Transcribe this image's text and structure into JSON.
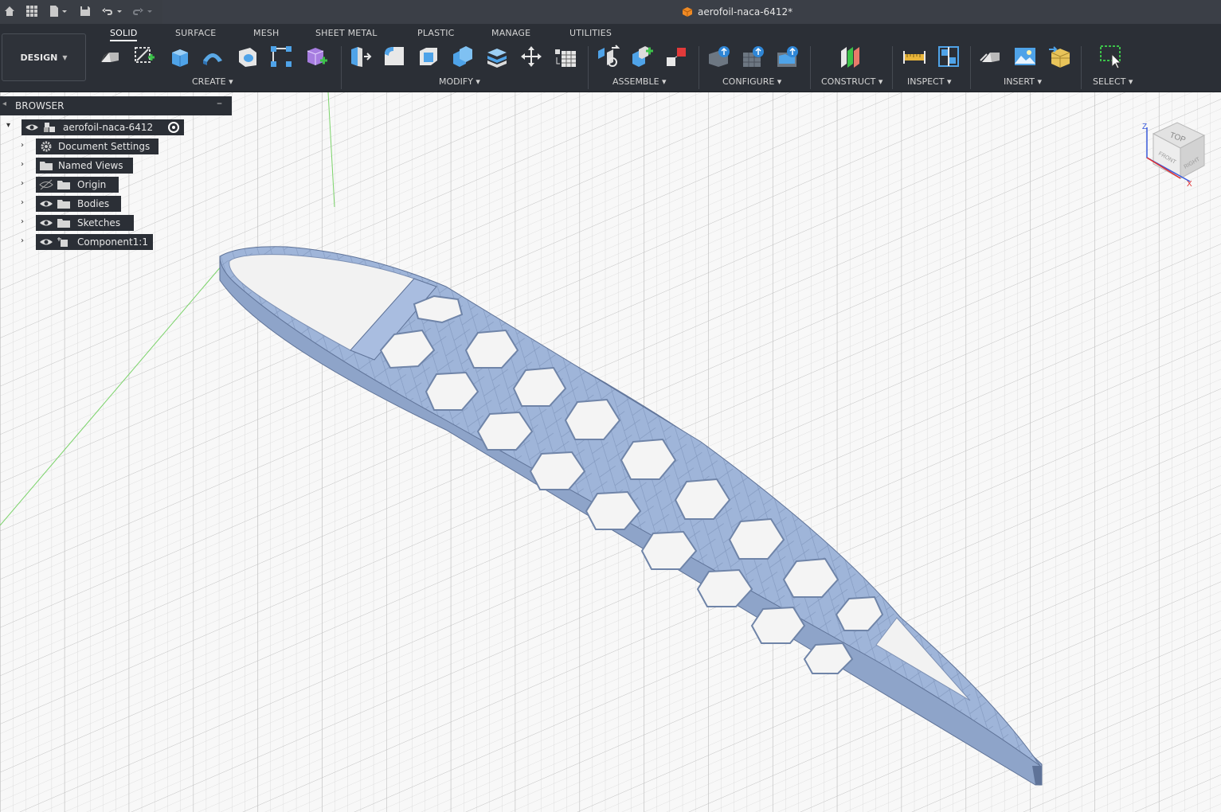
{
  "document": {
    "title": "aerofoil-naca-6412*"
  },
  "workspace": {
    "label": "DESIGN"
  },
  "tabs": [
    {
      "label": "SOLID"
    },
    {
      "label": "SURFACE"
    },
    {
      "label": "MESH"
    },
    {
      "label": "SHEET METAL"
    },
    {
      "label": "PLASTIC"
    },
    {
      "label": "MANAGE"
    },
    {
      "label": "UTILITIES"
    }
  ],
  "groups": {
    "create": "CREATE",
    "modify": "MODIFY",
    "assemble": "ASSEMBLE",
    "configure": "CONFIGURE",
    "construct": "CONSTRUCT",
    "inspect": "INSPECT",
    "insert": "INSERT",
    "select": "SELECT"
  },
  "browser": {
    "title": "BROWSER",
    "root": "aerofoil-naca-6412",
    "items": [
      {
        "label": "Document Settings"
      },
      {
        "label": "Named Views"
      },
      {
        "label": "Origin"
      },
      {
        "label": "Bodies"
      },
      {
        "label": "Sketches"
      },
      {
        "label": "Component1:1"
      }
    ]
  },
  "viewcube": {
    "top": "TOP",
    "front": "FRONT",
    "right": "RIGHT",
    "z": "Z",
    "x": "X"
  },
  "colors": {
    "toolbar": "#2b2f36",
    "body": "#9fb5d9",
    "body_edge": "#6f84a8",
    "accent": "#ffffff"
  }
}
